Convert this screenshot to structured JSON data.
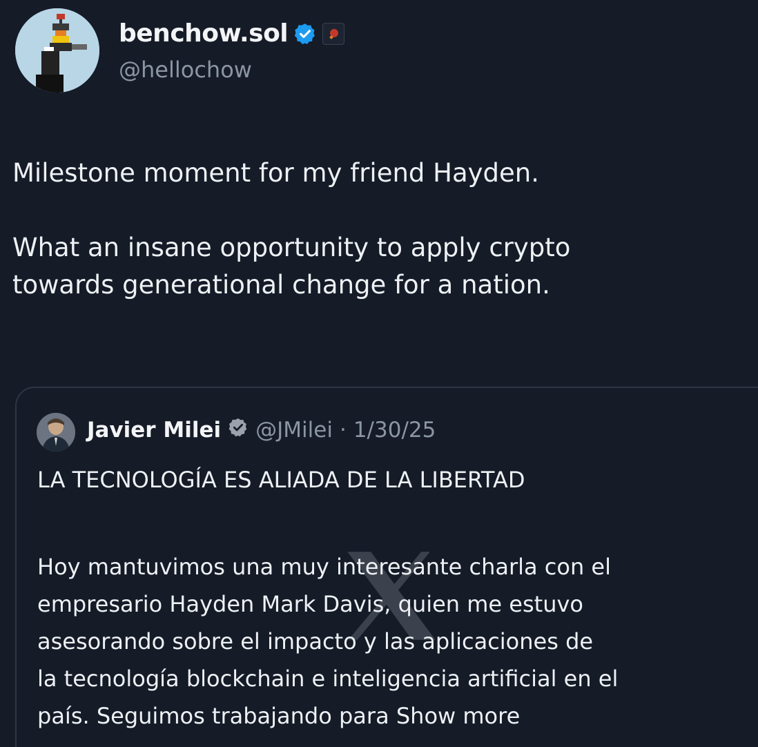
{
  "author": {
    "display_name": "benchow.sol",
    "handle": "@hellochow",
    "avatar_icon": "pixel-art-avatar",
    "verified_icon": "verified-badge-icon",
    "affiliate_icon": "affiliate-badge-icon"
  },
  "tweet": {
    "lines": [
      "Milestone moment for my friend Hayden.",
      "",
      "What an insane opportunity to apply crypto",
      "towards generational change for a nation."
    ]
  },
  "quoted": {
    "display_name": "Javier Milei",
    "handle": "@JMilei",
    "separator": "·",
    "date": "1/30/25",
    "title": "LA TECNOLOGÍA ES ALIADA DE LA LIBERTAD",
    "body_lines": [
      "Hoy mantuvimos una muy interesante charla con el",
      "empresario Hayden Mark Davis, quien me estuvo",
      "asesorando sobre el impacto y las aplicaciones de",
      "la tecnología blockchain e inteligencia artificial en el",
      "país. Seguimos trabajando para"
    ],
    "show_more": "Show more",
    "verified_icon": "verified-badge-gray-icon"
  },
  "colors": {
    "background": "#151b27",
    "verified_blue": "#1d9bf0",
    "muted_text": "#8b96a3"
  }
}
